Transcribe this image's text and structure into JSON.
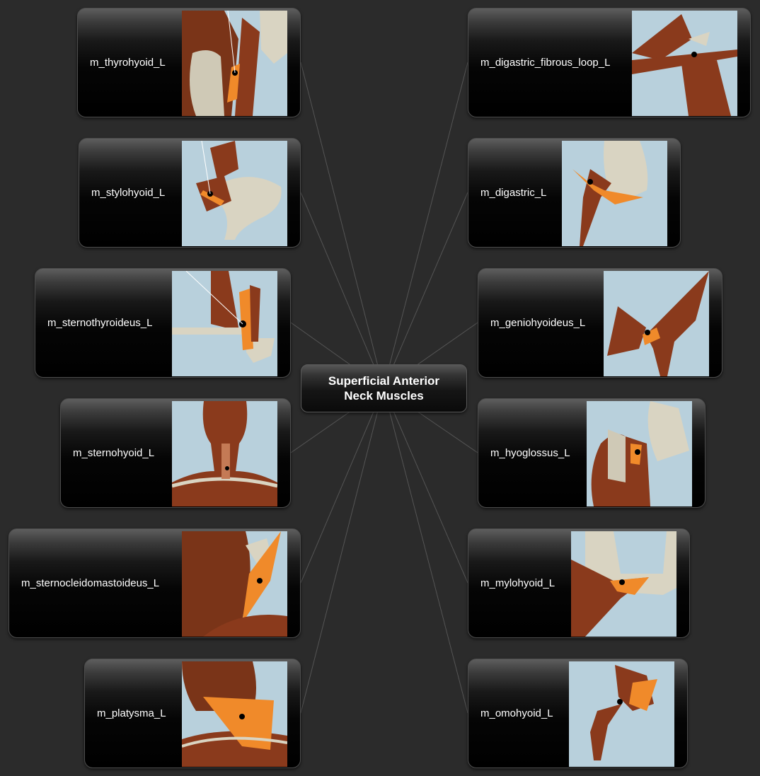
{
  "center": {
    "line1": "Superficial Anterior",
    "line2": "Neck Muscles"
  },
  "colors": {
    "background": "#2b2b2b",
    "connector": "#555555",
    "muscle": "#8a3a1c",
    "highlight": "#f08a2a",
    "bone": "#d9d4c2",
    "thumbnail_bg": "#b8d0dc"
  },
  "nodes": [
    {
      "id": "thyrohyoid",
      "label": "m_thyrohyoid_L",
      "side": "left",
      "image": "thyrohyoid-render"
    },
    {
      "id": "stylohyoid",
      "label": "m_stylohyoid_L",
      "side": "left",
      "image": "stylohyoid-render"
    },
    {
      "id": "sternothyroideus",
      "label": "m_sternothyroideus_L",
      "side": "left",
      "image": "sternothyroideus-render"
    },
    {
      "id": "sternohyoid",
      "label": "m_sternohyoid_L",
      "side": "left",
      "image": "sternohyoid-render"
    },
    {
      "id": "sternocleidomastoideus",
      "label": "m_sternocleidomastoideus_L",
      "side": "left",
      "image": "sternocleidomastoideus-render"
    },
    {
      "id": "platysma",
      "label": "m_platysma_L",
      "side": "left",
      "image": "platysma-render"
    },
    {
      "id": "digastric_fibrous_loop",
      "label": "m_digastric_fibrous_loop_L",
      "side": "right",
      "image": "digastric-fibrous-loop-render"
    },
    {
      "id": "digastric",
      "label": "m_digastric_L",
      "side": "right",
      "image": "digastric-render"
    },
    {
      "id": "geniohyoideus",
      "label": "m_geniohyoideus_L",
      "side": "right",
      "image": "geniohyoideus-render"
    },
    {
      "id": "hyoglossus",
      "label": "m_hyoglossus_L",
      "side": "right",
      "image": "hyoglossus-render"
    },
    {
      "id": "mylohyoid",
      "label": "m_mylohyoid_L",
      "side": "right",
      "image": "mylohyoid-render"
    },
    {
      "id": "omohyoid",
      "label": "m_omohyoid_L",
      "side": "right",
      "image": "omohyoid-render"
    }
  ]
}
